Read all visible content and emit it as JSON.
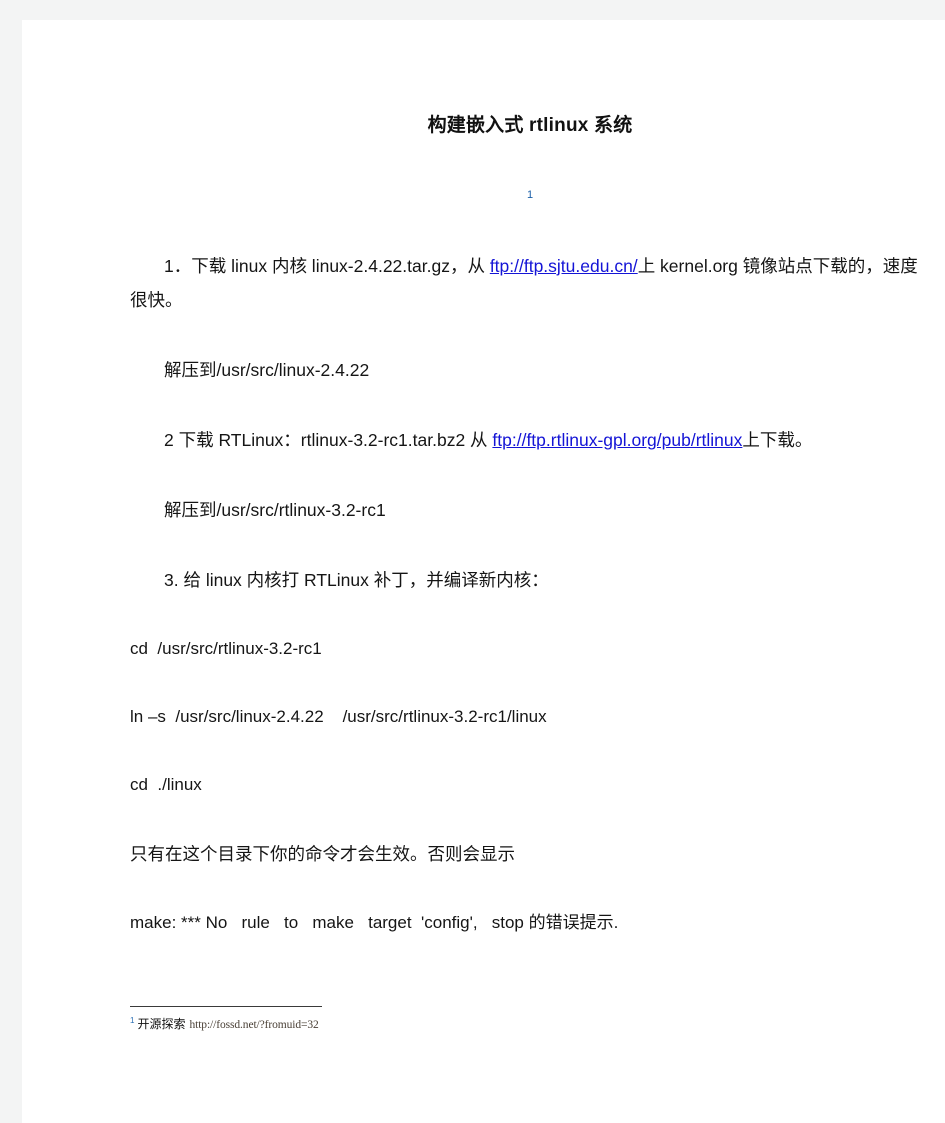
{
  "page": {
    "background_color": "#f3f4f4",
    "paper_color": "#ffffff",
    "link_color": "#1414d6",
    "text_color": "#151515"
  },
  "document": {
    "title": "构建嵌入式 rtlinux 系统",
    "footnote_ref": "1",
    "blocks": [
      {
        "id": "step-1",
        "parts": [
          {
            "type": "text",
            "value": "1．下载 linux 内核 linux-2.4.22.tar.gz，从 "
          },
          {
            "type": "link",
            "value": "ftp://ftp.sjtu.edu.cn/"
          },
          {
            "type": "text",
            "value": "上 kernel.org 镜像站点下载的，速度很快。"
          }
        ]
      },
      {
        "id": "extract-1",
        "parts": [
          {
            "type": "text",
            "value": "解压到/usr/src/linux-2.4.22"
          }
        ]
      },
      {
        "id": "step-2",
        "parts": [
          {
            "type": "text",
            "value": "2 下载 RTLinux：rtlinux-3.2-rc1.tar.bz2  从 "
          },
          {
            "type": "link",
            "value": "ftp://ftp.rtlinux-gpl.org/pub/rtlinux"
          },
          {
            "type": "text",
            "value": "上下载。"
          }
        ]
      },
      {
        "id": "extract-2",
        "parts": [
          {
            "type": "text",
            "value": "解压到/usr/src/rtlinux-3.2-rc1"
          }
        ]
      },
      {
        "id": "step-3",
        "parts": [
          {
            "type": "text",
            "value": "3. 给 linux 内核打 RTLinux 补丁，并编译新内核："
          }
        ]
      },
      {
        "id": "cmd-cd-rtlinux",
        "parts": [
          {
            "type": "text",
            "value": "cd  /usr/src/rtlinux-3.2-rc1"
          }
        ]
      },
      {
        "id": "cmd-ln-s",
        "parts": [
          {
            "type": "text",
            "value": "ln –s  /usr/src/linux-2.4.22    /usr/src/rtlinux-3.2-rc1/linux"
          }
        ]
      },
      {
        "id": "cmd-cd-linux",
        "parts": [
          {
            "type": "text",
            "value": "cd  ./linux"
          }
        ]
      },
      {
        "id": "note-dir",
        "parts": [
          {
            "type": "text",
            "value": "只有在这个目录下你的命令才会生效。否则会显示"
          }
        ]
      },
      {
        "id": "error-make",
        "parts": [
          {
            "type": "text",
            "value": "make: *** No   rule   to   make   target  'config',   stop 的错误提示."
          }
        ]
      }
    ],
    "footnote": {
      "marker": "1",
      "label": "开源探索",
      "url": "http://fossd.net/?fromuid=32"
    }
  }
}
